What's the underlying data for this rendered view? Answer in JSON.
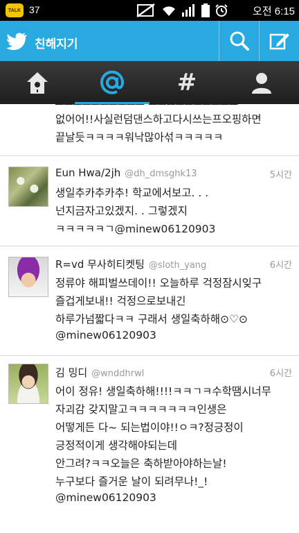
{
  "status_bar": {
    "talk_label": "TALK",
    "notification_count": "37",
    "time": "오전 6:15"
  },
  "app_bar": {
    "title": "친해지기"
  },
  "tabs": [
    "home",
    "mentions",
    "#",
    "profile"
  ],
  "colors": {
    "twitter_blue": "#28a9e0",
    "tab_bar": "#2a2a2a",
    "muted_text": "#999999"
  },
  "tweets": [
    {
      "partial_top": "",
      "lines": [
        "없어어!!사실런덤댄스하고다시쓰는프오핑하면",
        "끝날듯ㅋㅋㅋㅋ워낙많아섞ㅋㅋㅋㅋㅋ"
      ]
    },
    {
      "name": "Eun Hwa/2jh",
      "handle": "@dh_dmsghk13",
      "time": "5시간",
      "lines": [
        "생일추카추카추!  학교에서보고. . .",
        "넌지금자고있겠지. . 그렇겠지",
        "ㅋㅋㅋㅋㅋㄱ@minew06120903"
      ]
    },
    {
      "name": "R=vd 무사히티켓팅",
      "handle": "@sloth_yang",
      "time": "6시간",
      "lines": [
        "정류야 해피벌쓰데이!! 오늘하루 걱정잠시잊구",
        "즐겁게보내!! 걱정으로보내긴",
        "하루가넘짧다ㅋㅋ 구래서 생일축하해⊙♡⊙",
        "@minew06120903"
      ]
    },
    {
      "name": "김 밍디",
      "handle": "@wnddhrwl",
      "time": "6시간",
      "lines": [
        "어이 정유! 생일축하해!!!!ㅋㅋㄱㅋ수학땜시너무",
        "자괴감 갖지말고ㅋㅋㅋㅋㅋㅋㅋ인생은",
        "어떻게든 다~ 되는법이야!!ㅇㅋ?정긍정이",
        "긍정적이게 생각해야되는데",
        "안그려?ㅋㅋ오늘은 축하받아야하는날!",
        "누구보다 즐거운 날이 되려무나!_!",
        "@minew06120903"
      ]
    }
  ]
}
